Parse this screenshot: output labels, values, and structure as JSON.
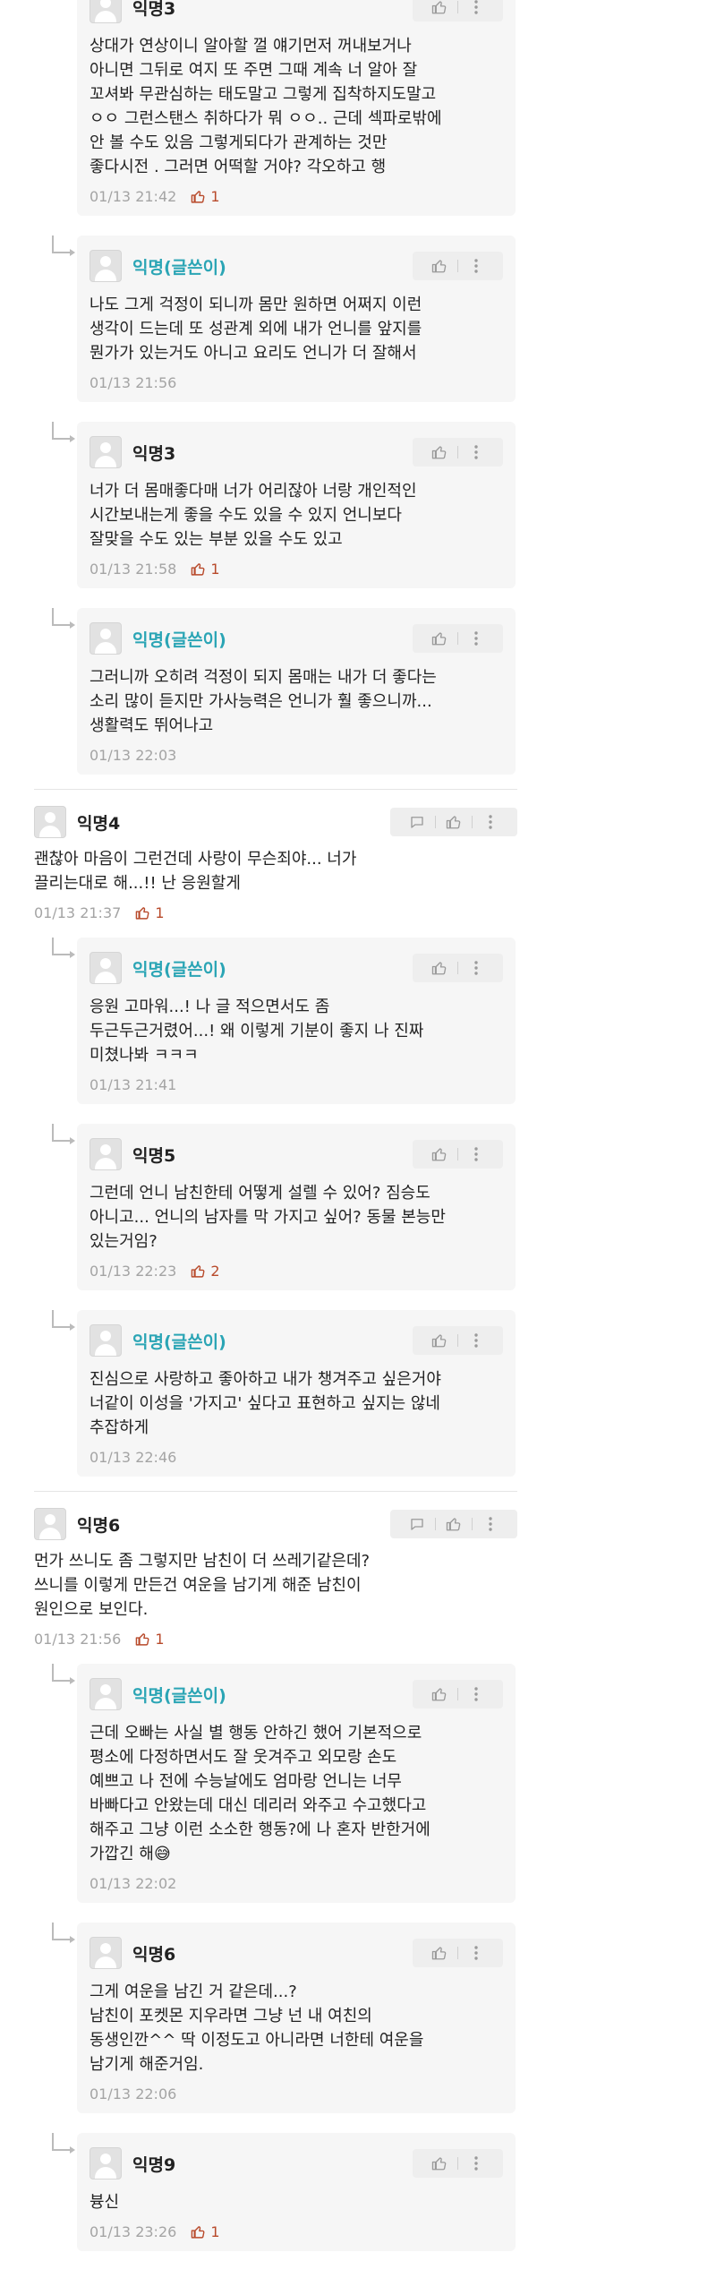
{
  "colors": {
    "op_name": "#2ba5b5",
    "like": "#b84a2b",
    "meta": "#a4a4a4"
  },
  "icons": {
    "like": "thumbs-up-icon",
    "more": "more-vertical-icon",
    "reply": "comment-bubble-icon"
  },
  "c1": {
    "name": "익명3",
    "text": "상대가 연상이니 알아할 껄 얘기먼저 꺼내보거나\n아니면 그뒤로 여지 또 주면 그때 계속 너 알아 잘\n꼬셔봐 무관심하는 태도말고 그렇게 집착하지도말고\nㅇㅇ 그런스탠스 취하다가 뭐 ㅇㅇ.. 근데 섹파로밖에\n안 볼 수도 있음 그렇게되다가 관계하는 것만\n좋다시전 . 그러면 어떡할 거야? 각오하고 행",
    "time": "01/13 21:42",
    "likes": "1"
  },
  "c2": {
    "name": "익명(글쓴이)",
    "text": "나도 그게 걱정이 되니까 몸만 원하면 어쩌지 이런\n생각이 드는데 또 성관계 외에 내가 언니를 앞지를\n뭔가가 있는거도 아니고 요리도 언니가 더 잘해서",
    "time": "01/13 21:56"
  },
  "c3": {
    "name": "익명3",
    "text": "너가 더 몸매좋다매 너가 어리잖아 너랑 개인적인\n시간보내는게 좋을 수도 있을 수 있지 언니보다\n잘맞을 수도 있는 부분 있을 수도 있고",
    "time": "01/13 21:58",
    "likes": "1"
  },
  "c4": {
    "name": "익명(글쓴이)",
    "text": "그러니까 오히려 걱정이 되지 몸매는 내가 더 좋다는\n소리 많이 듣지만 가사능력은 언니가 훨 좋으니까...\n생활력도 뛰어나고",
    "time": "01/13 22:03"
  },
  "c5": {
    "name": "익명4",
    "text": "괜찮아 마음이 그런건데 사랑이 무슨죄야... 너가\n끌리는대로 해...!! 난 응원할게",
    "time": "01/13 21:37",
    "likes": "1"
  },
  "c6": {
    "name": "익명(글쓴이)",
    "text": "응원 고마워...! 나 글 적으면서도 좀\n두근두근거렸어...! 왜 이렇게 기분이 좋지 나 진짜\n미쳤나봐 ㅋㅋㅋ",
    "time": "01/13 21:41"
  },
  "c7": {
    "name": "익명5",
    "text": "그런데 언니 남친한테 어떻게 설렐 수 있어? 짐승도\n아니고... 언니의 남자를 막 가지고 싶어? 동물 본능만\n있는거임?",
    "time": "01/13 22:23",
    "likes": "2"
  },
  "c8": {
    "name": "익명(글쓴이)",
    "text": "진심으로 사랑하고 좋아하고 내가 챙겨주고 싶은거야\n너같이 이성을 '가지고' 싶다고 표현하고 싶지는 않네\n추잡하게",
    "time": "01/13 22:46"
  },
  "c9": {
    "name": "익명6",
    "text": "먼가 쓰니도 좀 그렇지만 남친이 더 쓰레기같은데?\n쓰니를 이렇게 만든건 여운을 남기게 해준 남친이\n원인으로 보인다.",
    "time": "01/13 21:56",
    "likes": "1"
  },
  "c10": {
    "name": "익명(글쓴이)",
    "text": "근데 오빠는 사실 별 행동 안하긴 했어 기본적으로\n평소에 다정하면서도 잘 웃겨주고 외모랑 손도\n예쁘고 나 전에 수능날에도 엄마랑 언니는 너무\n바빠다고 안왔는데 대신 데리러 와주고 수고했다고\n해주고 그냥 이런 소소한 행동?에 나 혼자 반한거에\n가깝긴 해",
    "emoji": "😅",
    "time": "01/13 22:02"
  },
  "c11": {
    "name": "익명6",
    "text": "그게 여운을 남긴 거 같은데...?\n남친이 포켓몬 지우라면 그냥 넌 내 여친의\n동생인깐^^ 딱 이정도고 아니라면 너한테 여운을\n남기게 해준거임.",
    "time": "01/13 22:06"
  },
  "c12": {
    "name": "익명9",
    "text": "븅신",
    "time": "01/13 23:26",
    "likes": "1"
  }
}
